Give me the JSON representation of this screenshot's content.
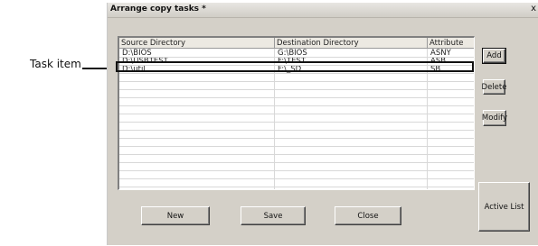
{
  "annotation": {
    "label": "Task item"
  },
  "window": {
    "title": "Arrange copy tasks *",
    "close_glyph": "x"
  },
  "table": {
    "columns": [
      "Source Directory",
      "Destination Directory",
      "Attribute"
    ],
    "rows": [
      [
        "D:\\BIOS",
        "G:\\BIOS",
        "ASNY"
      ],
      [
        "D:\\USBTEST",
        "F:\\TEST",
        "ASB"
      ],
      [
        "D:\\util",
        "F:\\_SD",
        "SB"
      ]
    ]
  },
  "buttons": {
    "add": "Add",
    "delete": "Delete",
    "modify": "Modify",
    "active_list": "Active List",
    "new": "New",
    "save": "Save",
    "close": "Close"
  }
}
